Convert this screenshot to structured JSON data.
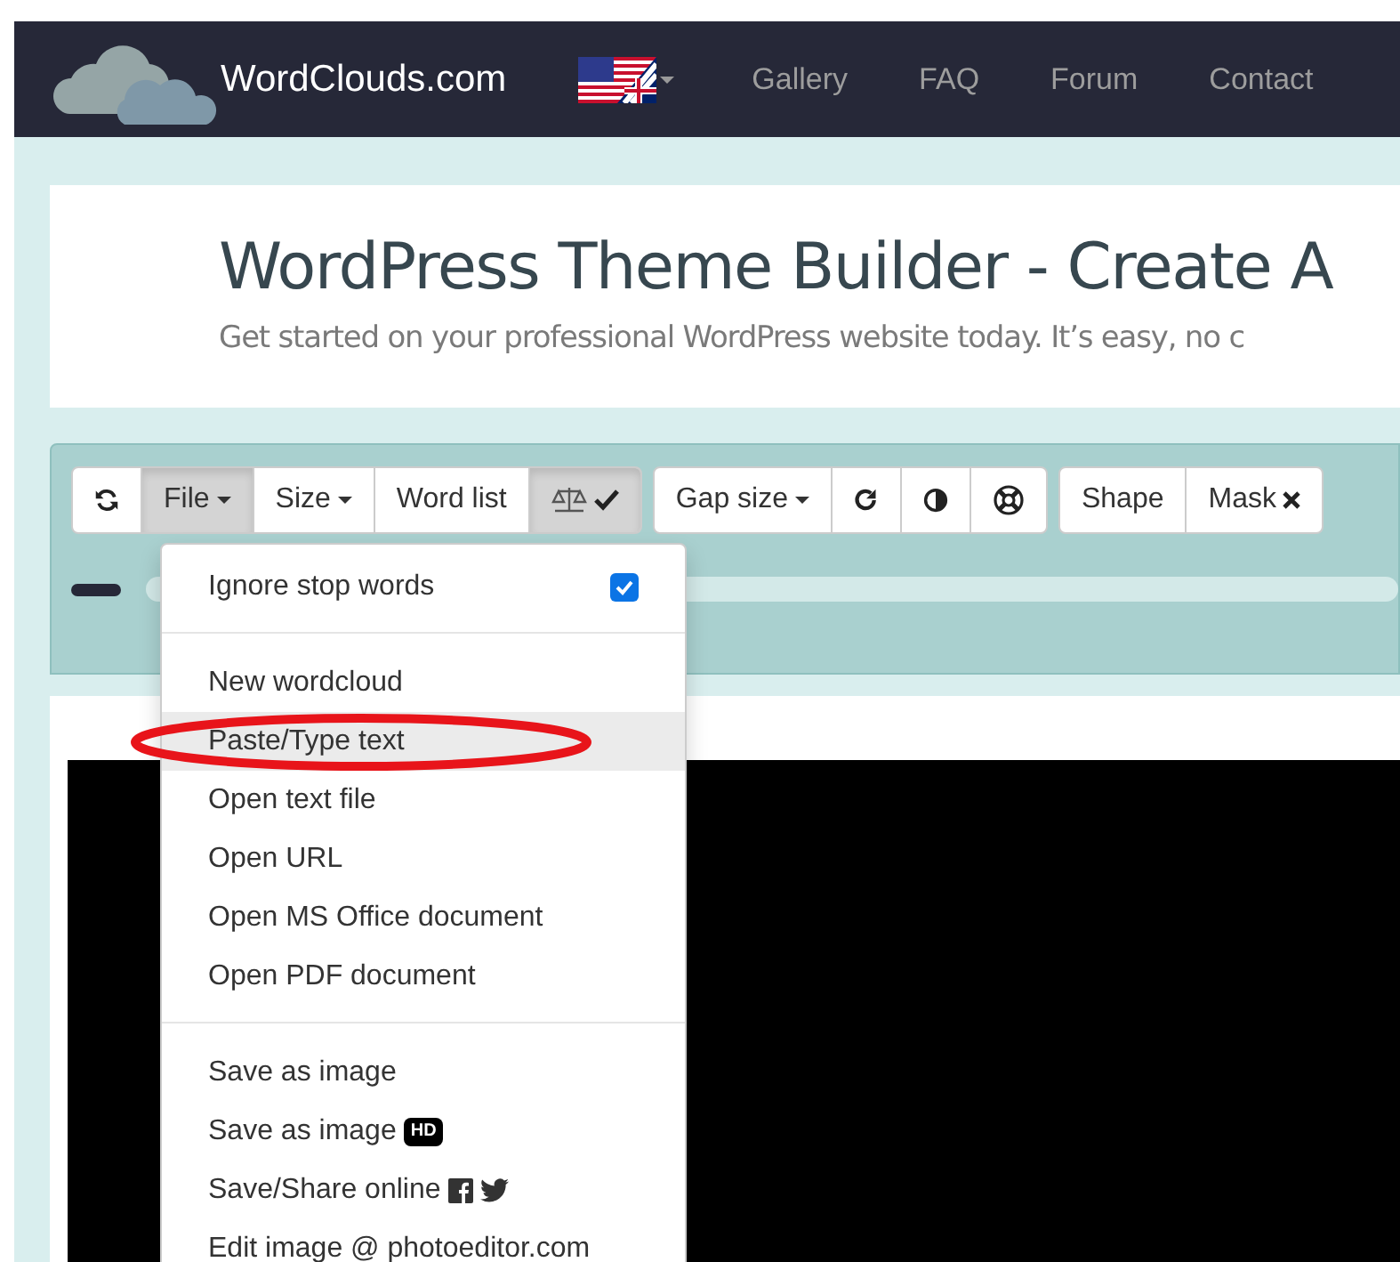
{
  "navbar": {
    "brand": "WordClouds.com",
    "links": [
      "Gallery",
      "FAQ",
      "Forum",
      "Contact"
    ]
  },
  "header": {
    "title": "WordPress Theme Builder - Create A",
    "subtitle": "Get started on your professional WordPress website today. It’s easy, no c"
  },
  "toolbar": {
    "groups": [
      [
        {
          "kind": "icon",
          "active": false
        },
        {
          "kind": "dropdown",
          "label": "File",
          "active": true
        },
        {
          "kind": "dropdown",
          "label": "Size",
          "active": false
        },
        {
          "kind": "text",
          "label": "Word list",
          "active": false
        },
        {
          "kind": "icon",
          "active": true
        }
      ],
      [
        {
          "kind": "dropdown",
          "label": "Gap size",
          "active": false
        },
        {
          "kind": "icon",
          "active": false
        },
        {
          "kind": "icon",
          "active": false
        },
        {
          "kind": "icon",
          "active": false
        }
      ],
      [
        {
          "kind": "text",
          "label": "Shape",
          "active": false
        },
        {
          "kind": "close",
          "label": "Mask",
          "active": false
        }
      ]
    ]
  },
  "file_menu": {
    "sections": [
      [
        {
          "kind": "checkbox",
          "label": "Ignore stop words",
          "checked": true,
          "selected": false
        }
      ],
      [
        {
          "kind": "plain",
          "label": "New wordcloud",
          "selected": false
        },
        {
          "kind": "plain",
          "label": "Paste/Type text",
          "selected": true
        },
        {
          "kind": "plain",
          "label": "Open text file",
          "selected": false
        },
        {
          "kind": "plain",
          "label": "Open URL",
          "selected": false
        },
        {
          "kind": "plain",
          "label": "Open MS Office document",
          "selected": false
        },
        {
          "kind": "plain",
          "label": "Open PDF document",
          "selected": false
        }
      ],
      [
        {
          "kind": "plain",
          "label": "Save as image",
          "selected": false
        },
        {
          "kind": "badge",
          "label": "Save as image",
          "badge": "HD",
          "selected": false
        },
        {
          "kind": "social",
          "label": "Save/Share online",
          "selected": false
        },
        {
          "kind": "plain",
          "label": "Edit image @ photoeditor.com",
          "selected": false
        }
      ]
    ]
  }
}
